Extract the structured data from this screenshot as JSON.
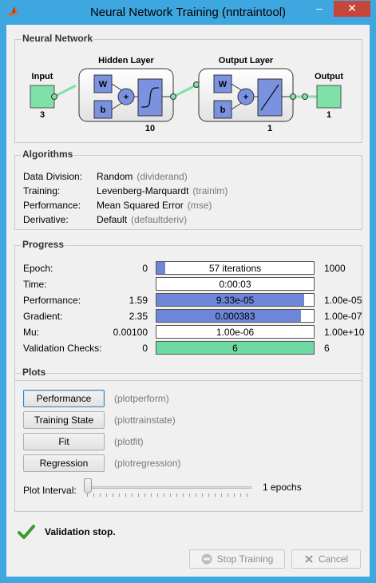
{
  "window": {
    "title": "Neural Network Training (nntraintool)"
  },
  "network": {
    "section_title": "Neural Network",
    "input_label": "Input",
    "input_size": "3",
    "hidden_label": "Hidden Layer",
    "hidden_size": "10",
    "output_layer_label": "Output Layer",
    "output_layer_size": "1",
    "output_label": "Output",
    "output_size": "1",
    "weight_symbol": "W",
    "bias_symbol": "b",
    "sum_symbol": "+"
  },
  "algorithms": {
    "section_title": "Algorithms",
    "rows": [
      {
        "label": "Data Division:",
        "value": "Random",
        "func": "(dividerand)"
      },
      {
        "label": "Training:",
        "value": "Levenberg-Marquardt",
        "func": "(trainlm)"
      },
      {
        "label": "Performance:",
        "value": "Mean Squared Error",
        "func": "(mse)"
      },
      {
        "label": "Derivative:",
        "value": "Default",
        "func": "(defaultderiv)"
      }
    ]
  },
  "progress": {
    "section_title": "Progress",
    "rows": [
      {
        "label": "Epoch:",
        "min": "0",
        "value": "57 iterations",
        "max": "1000",
        "fill": 0.057,
        "color": "#6d86d8"
      },
      {
        "label": "Time:",
        "min": "",
        "value": "0:00:03",
        "max": "",
        "fill": 0,
        "color": "#6d86d8"
      },
      {
        "label": "Performance:",
        "min": "1.59",
        "value": "9.33e-05",
        "max": "1.00e-05",
        "fill": 0.94,
        "color": "#6d86d8"
      },
      {
        "label": "Gradient:",
        "min": "2.35",
        "value": "0.000383",
        "max": "1.00e-07",
        "fill": 0.92,
        "color": "#6d86d8"
      },
      {
        "label": "Mu:",
        "min": "0.00100",
        "value": "1.00e-06",
        "max": "1.00e+10",
        "fill": 0,
        "color": "#6d86d8"
      },
      {
        "label": "Validation Checks:",
        "min": "0",
        "value": "6",
        "max": "6",
        "fill": 1.0,
        "color": "#6fd9a4"
      }
    ]
  },
  "plots": {
    "section_title": "Plots",
    "buttons": [
      {
        "label": "Performance",
        "func": "(plotperform)"
      },
      {
        "label": "Training State",
        "func": "(plottrainstate)"
      },
      {
        "label": "Fit",
        "func": "(plotfit)"
      },
      {
        "label": "Regression",
        "func": "(plotregression)"
      }
    ],
    "interval_label": "Plot Interval:",
    "interval_value": "1 epochs"
  },
  "status": {
    "text": "Validation stop.",
    "icon": "checkmark-icon"
  },
  "footer": {
    "stop_label": "Stop Training",
    "cancel_label": "Cancel"
  }
}
